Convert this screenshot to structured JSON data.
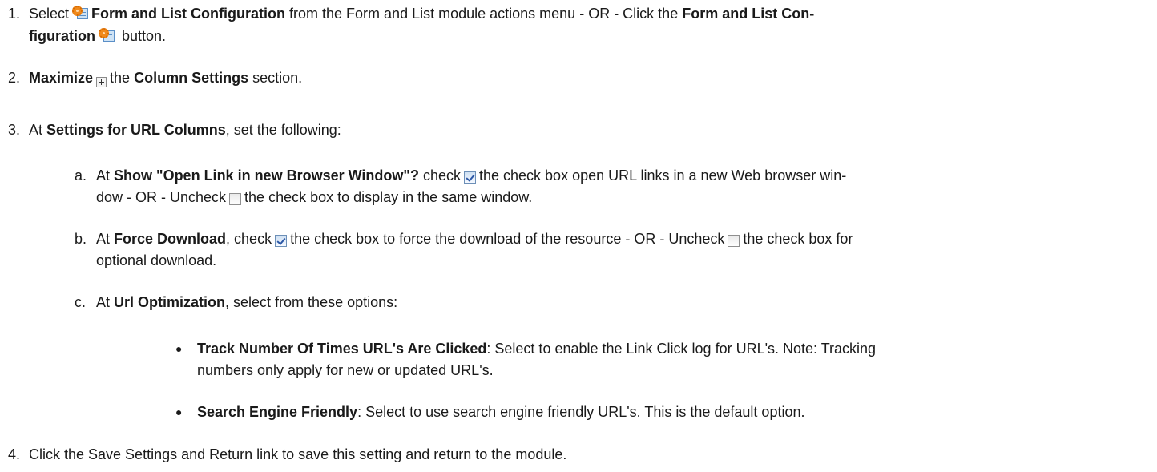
{
  "steps": [
    {
      "number": "1.",
      "line1": {
        "t1": "Select",
        "icon": "form-and-list-configuration-icon",
        "b1": "Form and List Configuration",
        "t2": "from the Form and List module actions menu - OR - Click the",
        "b2": "Form and List Con-"
      },
      "line2": {
        "b1": "figuration",
        "icon": "form-and-list-configuration-icon",
        "t1": "button."
      }
    },
    {
      "number": "2.",
      "b1": "Maximize",
      "icon": "maximize-icon",
      "t1": "the",
      "b2": "Column Settings",
      "t2": "section."
    },
    {
      "number": "3.",
      "t1": "At",
      "b1": "Settings for URL Columns",
      "t2": ", set the following:",
      "substeps": [
        {
          "letter": "a.",
          "line1": {
            "t1": "At",
            "b1": "Show \"Open Link in new Browser Window\"?",
            "t2": "check",
            "t3": "the check box open URL links in a new Web browser win-"
          },
          "line2": {
            "t1": "dow - OR - Uncheck",
            "t2": "the check box to display in the same window."
          }
        },
        {
          "letter": "b.",
          "line1": {
            "t1": "At",
            "b1": "Force Download",
            "t2": ", check",
            "t3": "the check box to force the download of the resource - OR - Uncheck",
            "t4": "the check box for"
          },
          "line2": {
            "t1": "optional download."
          }
        },
        {
          "letter": "c.",
          "t1": "At",
          "b1": "Url Optimization",
          "t2": ", select from these options:",
          "bullets": [
            {
              "b1": "Track Number Of Times URL's Are Clicked",
              "t1": ": Select to enable the Link Click log for URL's. Note: Tracking",
              "t2": "numbers only apply for new or updated URL's."
            },
            {
              "b1": "Search Engine Friendly",
              "t1": ": Select to use search engine friendly URL's. This is the default option."
            }
          ]
        }
      ]
    },
    {
      "number": "4.",
      "t1": "Click the Save Settings and Return link to save this setting and return to the module."
    }
  ],
  "icons": {
    "checked": "checked-checkbox-icon",
    "unchecked": "unchecked-checkbox-icon",
    "bullet": "bullet-icon"
  }
}
